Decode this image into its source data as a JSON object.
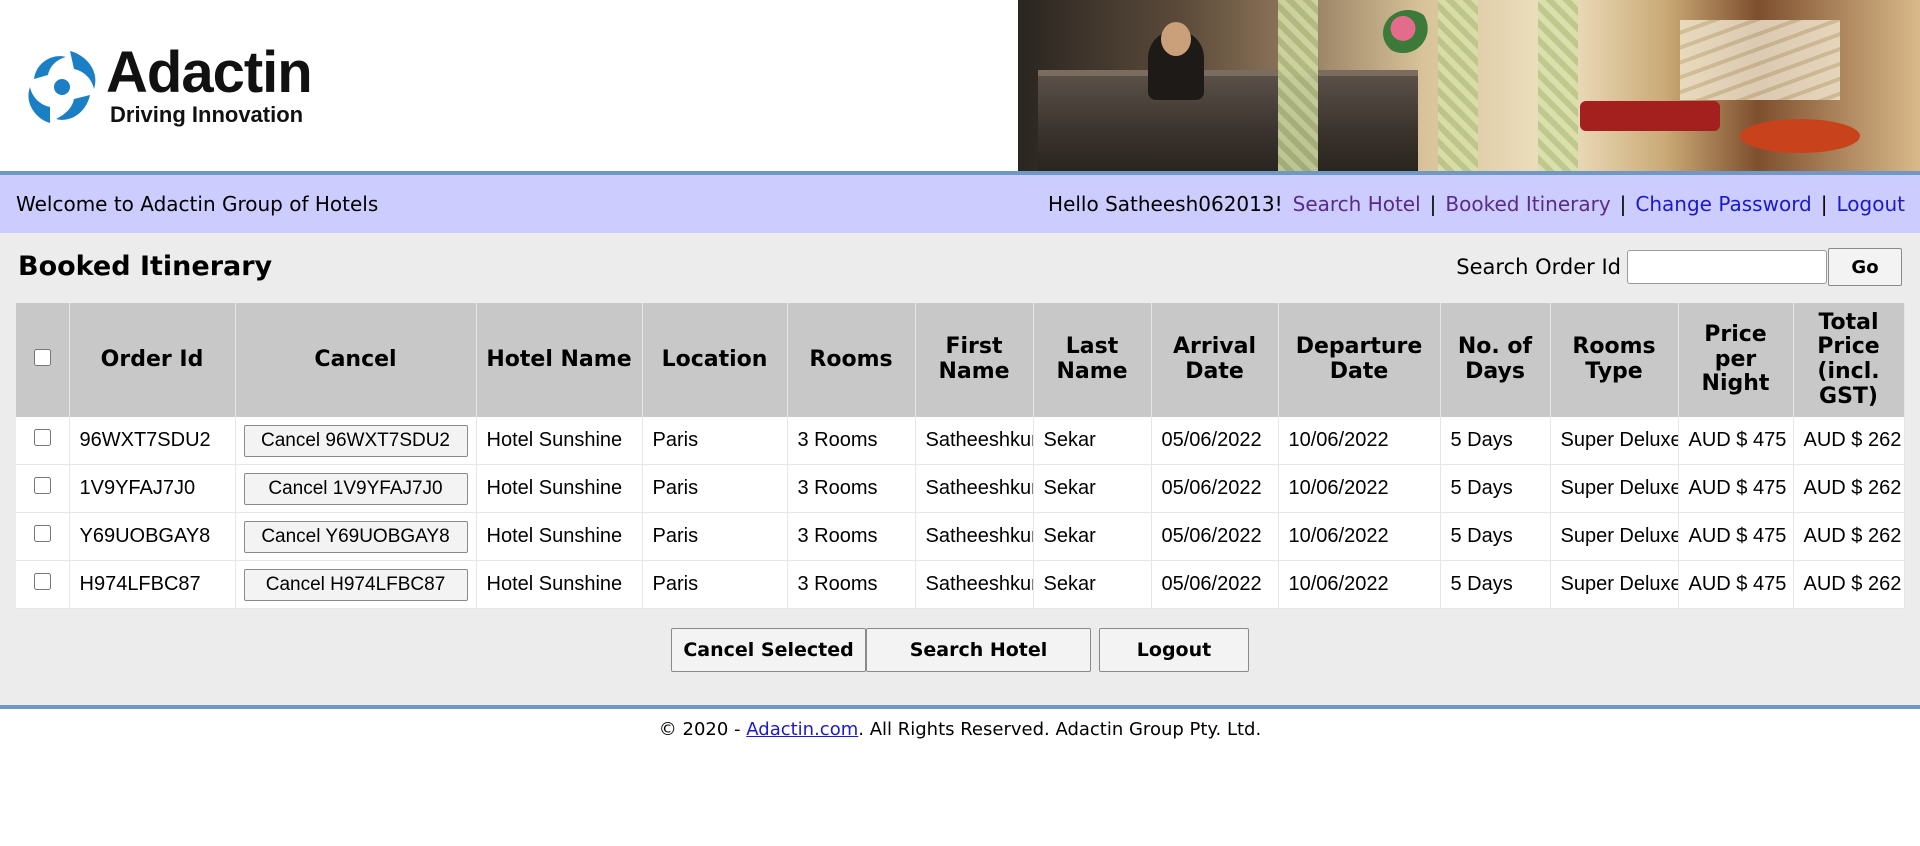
{
  "brand": {
    "name": "Adactin",
    "tagline": "Driving Innovation"
  },
  "navbar": {
    "welcome": "Welcome to Adactin Group of Hotels",
    "hello": "Hello Satheesh062013!",
    "links": [
      "Search Hotel",
      "Booked Itinerary",
      "Change Password",
      "Logout"
    ],
    "separator": "|"
  },
  "main": {
    "title": "Booked Itinerary",
    "search_label": "Search Order Id",
    "search_value": "",
    "go_label": "Go"
  },
  "table": {
    "headers": [
      "Order Id",
      "Cancel",
      "Hotel Name",
      "Location",
      "Rooms",
      "First Name",
      "Last Name",
      "Arrival Date",
      "Departure Date",
      "No. of Days",
      "Rooms Type",
      "Price per Night",
      "Total Price (incl. GST)"
    ],
    "rows": [
      {
        "order_id": "96WXT7SDU2",
        "cancel": "Cancel 96WXT7SDU2",
        "hotel": "Hotel Sunshine",
        "location": "Paris",
        "rooms": "3 Rooms",
        "first": "Satheeshkumar",
        "last": "Sekar",
        "arrival": "05/06/2022",
        "departure": "10/06/2022",
        "days": "5 Days",
        "room_type": "Super Deluxe",
        "price": "AUD $ 475",
        "total": "AUD $ 262"
      },
      {
        "order_id": "1V9YFAJ7J0",
        "cancel": "Cancel 1V9YFAJ7J0",
        "hotel": "Hotel Sunshine",
        "location": "Paris",
        "rooms": "3 Rooms",
        "first": "Satheeshkumar",
        "last": "Sekar",
        "arrival": "05/06/2022",
        "departure": "10/06/2022",
        "days": "5 Days",
        "room_type": "Super Deluxe",
        "price": "AUD $ 475",
        "total": "AUD $ 262"
      },
      {
        "order_id": "Y69UOBGAY8",
        "cancel": "Cancel Y69UOBGAY8",
        "hotel": "Hotel Sunshine",
        "location": "Paris",
        "rooms": "3 Rooms",
        "first": "Satheeshkumar",
        "last": "Sekar",
        "arrival": "05/06/2022",
        "departure": "10/06/2022",
        "days": "5 Days",
        "room_type": "Super Deluxe",
        "price": "AUD $ 475",
        "total": "AUD $ 262"
      },
      {
        "order_id": "H974LFBC87",
        "cancel": "Cancel H974LFBC87",
        "hotel": "Hotel Sunshine",
        "location": "Paris",
        "rooms": "3 Rooms",
        "first": "Satheeshkumar",
        "last": "Sekar",
        "arrival": "05/06/2022",
        "departure": "10/06/2022",
        "days": "5 Days",
        "room_type": "Super Deluxe",
        "price": "AUD $ 475",
        "total": "AUD $ 262"
      }
    ]
  },
  "actions": {
    "cancel_selected": "Cancel Selected",
    "search_hotel": "Search Hotel",
    "logout": "Logout"
  },
  "footer": {
    "prefix": "© 2020 - ",
    "link": "Adactin.com",
    "suffix": ". All Rights Reserved. Adactin Group Pty. Ltd."
  },
  "colors": {
    "navbar_bg": "#ccccff",
    "header_bg": "#c8c8c8",
    "divider": "#6f98c6",
    "link": "#1a1acc",
    "visited_link": "#5a2a8a"
  }
}
